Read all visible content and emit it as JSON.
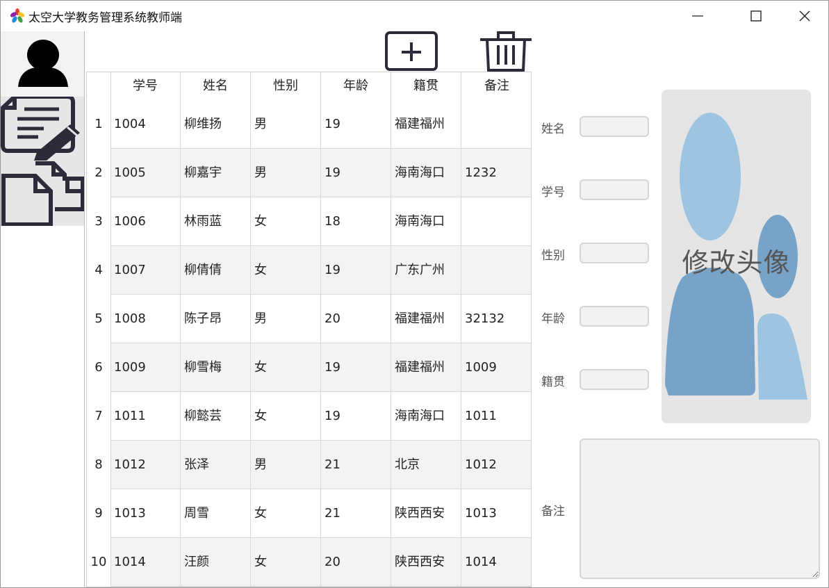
{
  "window": {
    "title": "太空大学教务管理系统教师端",
    "controls": {
      "minimize": "minimize-icon",
      "maximize": "maximize-icon",
      "close": "close-icon"
    }
  },
  "sidebar": {
    "items": [
      {
        "id": "user",
        "icon": "user-icon"
      },
      {
        "id": "edit",
        "icon": "document-edit-icon"
      },
      {
        "id": "files",
        "icon": "files-icon"
      }
    ]
  },
  "toolbar": {
    "add_icon": "add-icon",
    "delete_icon": "trash-icon"
  },
  "table": {
    "headers": [
      "学号",
      "姓名",
      "性别",
      "年龄",
      "籍贯",
      "备注"
    ],
    "rows": [
      {
        "num": "1",
        "cells": [
          "1004",
          "柳维扬",
          "男",
          "19",
          "福建福州",
          ""
        ]
      },
      {
        "num": "2",
        "cells": [
          "1005",
          "柳嘉宇",
          "男",
          "19",
          "海南海口",
          "1232"
        ]
      },
      {
        "num": "3",
        "cells": [
          "1006",
          "林雨蓝",
          "女",
          "18",
          "海南海口",
          ""
        ]
      },
      {
        "num": "4",
        "cells": [
          "1007",
          "柳倩倩",
          "女",
          "19",
          "广东广州",
          ""
        ]
      },
      {
        "num": "5",
        "cells": [
          "1008",
          "陈子昂",
          "男",
          "20",
          "福建福州",
          "32132"
        ]
      },
      {
        "num": "6",
        "cells": [
          "1009",
          "柳雪梅",
          "女",
          "19",
          "福建福州",
          "1009"
        ]
      },
      {
        "num": "7",
        "cells": [
          "1011",
          "柳懿芸",
          "女",
          "19",
          "海南海口",
          "1011"
        ]
      },
      {
        "num": "8",
        "cells": [
          "1012",
          "张泽",
          "男",
          "21",
          "北京",
          "1012"
        ]
      },
      {
        "num": "9",
        "cells": [
          "1013",
          "周雪",
          "女",
          "21",
          "陕西西安",
          "1013"
        ]
      },
      {
        "num": "10",
        "cells": [
          "1014",
          "汪颜",
          "女",
          "20",
          "陕西西安",
          "1014"
        ]
      }
    ]
  },
  "form": {
    "labels": {
      "name": "姓名",
      "id": "学号",
      "gender": "性别",
      "age": "年龄",
      "origin": "籍贯",
      "notes": "备注"
    },
    "values": {
      "name": "",
      "id": "",
      "gender": "",
      "age": "",
      "origin": "",
      "notes": ""
    }
  },
  "avatar": {
    "label": "修改头像"
  },
  "colors": {
    "avatar_light": "#9dc5e1",
    "avatar_dark": "#77a3c9",
    "avatar_bg": "#e5e5e5",
    "icon_dark": "#2b2b3a"
  }
}
